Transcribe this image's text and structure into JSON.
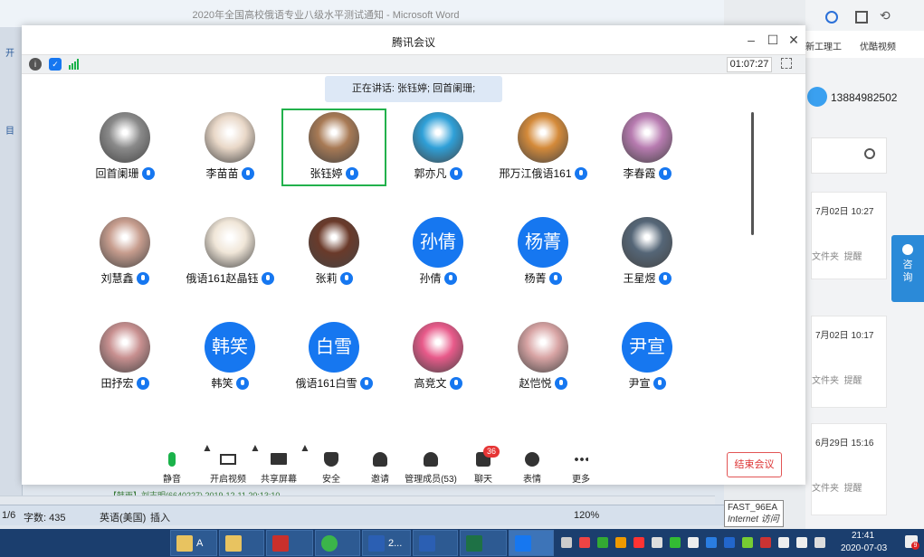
{
  "word": {
    "title": "2020年全国高校俄语专业八级水平测试通知 - Microsoft Word",
    "status_page": "1/6",
    "status_words": "字数: 435",
    "status_lang": "英语(美国)",
    "status_insert": "插入",
    "zoom": "120%",
    "comment_snippet": "【韩雨】刘志明(6640227) 2019-12-11 20:13:10"
  },
  "browser": {
    "bookmark_1": "新工理工",
    "bookmark_2": "优酷视频",
    "phone": "13884982502",
    "consult_label": "咨询",
    "cards": [
      {
        "date": "7月02日 10:27",
        "col1": "文件夹",
        "col2": "提醒"
      },
      {
        "date": "7月02日 10:17",
        "col1": "文件夹",
        "col2": "提醒"
      },
      {
        "date": "6月29日 15:16",
        "col1": "文件夹",
        "col2": "提醒"
      }
    ]
  },
  "meeting": {
    "title": "腾讯会议",
    "timer": "01:07:27",
    "speaking": "正在讲话: 张钰婷; 回首阑珊;",
    "participants": [
      {
        "name": "回首阑珊",
        "avatar_text": ""
      },
      {
        "name": "李苗苗",
        "avatar_text": ""
      },
      {
        "name": "张钰婷",
        "avatar_text": "",
        "active": true
      },
      {
        "name": "郭亦凡",
        "avatar_text": ""
      },
      {
        "name": "邢万江俄语161",
        "avatar_text": ""
      },
      {
        "name": "李春霞",
        "avatar_text": ""
      },
      {
        "name": "刘慧鑫",
        "avatar_text": ""
      },
      {
        "name": "俄语161赵晶钰",
        "avatar_text": ""
      },
      {
        "name": "张莉",
        "avatar_text": ""
      },
      {
        "name": "孙倩",
        "avatar_text": "孙倩"
      },
      {
        "name": "杨菁",
        "avatar_text": "杨菁"
      },
      {
        "name": "王星煜",
        "avatar_text": ""
      },
      {
        "name": "田抒宏",
        "avatar_text": ""
      },
      {
        "name": "韩笑",
        "avatar_text": "韩笑"
      },
      {
        "name": "俄语161白雪",
        "avatar_text": "白雪"
      },
      {
        "name": "高竞文",
        "avatar_text": ""
      },
      {
        "name": "赵恺悦",
        "avatar_text": ""
      },
      {
        "name": "尹宣",
        "avatar_text": "尹宣"
      }
    ],
    "toolbar": {
      "mute": "静音",
      "video": "开启视频",
      "share": "共享屏幕",
      "security": "安全",
      "invite": "邀请",
      "manage": "管理成员(53)",
      "chat": "聊天",
      "chat_badge": "36",
      "reactions": "表情",
      "more": "更多",
      "end": "结束会议"
    }
  },
  "tooltip": {
    "line1": "FAST_96EA",
    "line2": "Internet 访问"
  },
  "taskbar": {
    "btn_a": "A",
    "btn_2": "2...",
    "time": "21:41",
    "date": "2020-07-03",
    "notif_badge": "9"
  }
}
